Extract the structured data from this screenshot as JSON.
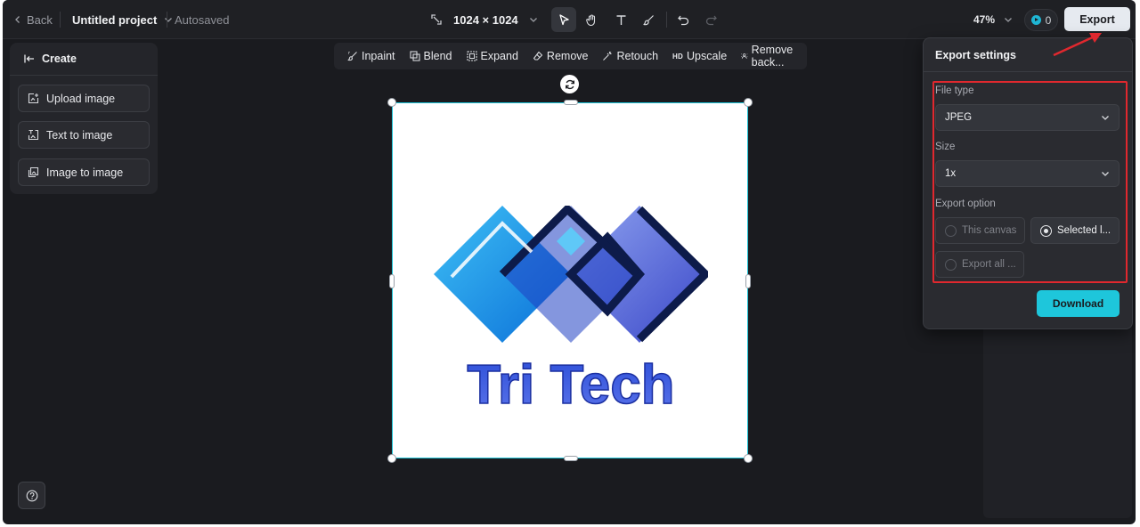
{
  "header": {
    "back_label": "Back",
    "project_title": "Untitled project",
    "autosave_status": "Autosaved",
    "canvas_size": "1024 × 1024",
    "zoom_level": "47%",
    "credits_count": "0",
    "export_label": "Export"
  },
  "left_panel": {
    "title": "Create",
    "items": [
      {
        "label": "Upload image",
        "icon": "upload-image-icon"
      },
      {
        "label": "Text to image",
        "icon": "text-to-image-icon"
      },
      {
        "label": "Image to image",
        "icon": "image-to-image-icon"
      }
    ]
  },
  "edit_toolbar": {
    "items": [
      {
        "label": "Inpaint",
        "icon": "inpaint-brush-icon"
      },
      {
        "label": "Blend",
        "icon": "blend-icon"
      },
      {
        "label": "Expand",
        "icon": "expand-icon"
      },
      {
        "label": "Remove",
        "icon": "eraser-icon"
      },
      {
        "label": "Retouch",
        "icon": "magic-wand-icon"
      },
      {
        "label": "Upscale",
        "icon": "hd-icon",
        "icon_text": "HD"
      },
      {
        "label": "Remove back...",
        "icon": "remove-background-icon"
      }
    ]
  },
  "canvas": {
    "image_text": "Tri Tech"
  },
  "export_panel": {
    "title": "Export settings",
    "file_type_label": "File type",
    "file_type_value": "JPEG",
    "size_label": "Size",
    "size_value": "1x",
    "export_option_label": "Export option",
    "options": [
      {
        "label": "This canvas",
        "selected": false
      },
      {
        "label": "Selected l...",
        "selected": true
      },
      {
        "label": "Export all ...",
        "selected": false
      }
    ],
    "download_label": "Download"
  },
  "colors": {
    "accent": "#1ec6db",
    "annotation_red": "#e0282e",
    "background": "#1a1b1f"
  }
}
